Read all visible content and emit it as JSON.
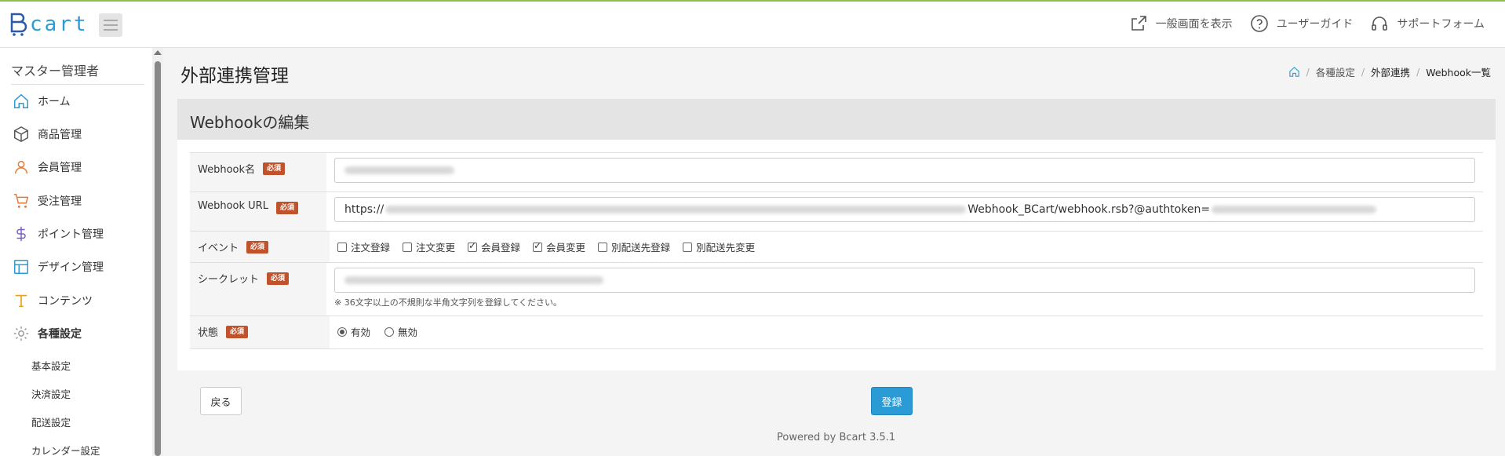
{
  "app": {
    "logo_text": "cart"
  },
  "header_links": [
    {
      "label": "一般画面を表示",
      "icon": "external-link-icon"
    },
    {
      "label": "ユーザーガイド",
      "icon": "help-circle-icon"
    },
    {
      "label": "サポートフォーム",
      "icon": "headset-icon"
    }
  ],
  "sidebar": {
    "title": "マスター管理者",
    "items": [
      {
        "label": "ホーム",
        "icon": "home-icon",
        "color": "#2b9bd6"
      },
      {
        "label": "商品管理",
        "icon": "box-icon",
        "color": "#555555"
      },
      {
        "label": "会員管理",
        "icon": "user-icon",
        "color": "#e07a3a"
      },
      {
        "label": "受注管理",
        "icon": "cart-icon",
        "color": "#e07a3a"
      },
      {
        "label": "ポイント管理",
        "icon": "dollar-icon",
        "color": "#7b5cc4"
      },
      {
        "label": "デザイン管理",
        "icon": "layout-icon",
        "color": "#2b9bd6"
      },
      {
        "label": "コンテンツ",
        "icon": "text-icon",
        "color": "#e8a020"
      },
      {
        "label": "各種設定",
        "icon": "gear-icon",
        "color": "#999999"
      }
    ],
    "sub_items": [
      "基本設定",
      "決済設定",
      "配送設定",
      "カレンダー設定"
    ]
  },
  "page": {
    "title": "外部連携管理",
    "breadcrumb": [
      "各種設定",
      "外部連携",
      "Webhook一覧"
    ]
  },
  "panel": {
    "title": "Webhookの編集",
    "required_badge": "必須",
    "fields": {
      "name_label": "Webhook名",
      "url_label": "Webhook URL",
      "url_prefix": "https://",
      "url_suffix": "Webhook_BCart/webhook.rsb?@authtoken=",
      "event_label": "イベント",
      "events": [
        {
          "label": "注文登録",
          "checked": false
        },
        {
          "label": "注文変更",
          "checked": false
        },
        {
          "label": "会員登録",
          "checked": true
        },
        {
          "label": "会員変更",
          "checked": true
        },
        {
          "label": "別配送先登録",
          "checked": false
        },
        {
          "label": "別配送先変更",
          "checked": false
        }
      ],
      "secret_label": "シークレット",
      "secret_note": "※ 36文字以上の不規則な半角文字列を登録してください。",
      "status_label": "状態",
      "status_options": [
        {
          "label": "有効",
          "selected": true
        },
        {
          "label": "無効",
          "selected": false
        }
      ]
    }
  },
  "actions": {
    "back_label": "戻る",
    "submit_label": "登録"
  },
  "footer": {
    "text": "Powered by Bcart 3.5.1"
  }
}
